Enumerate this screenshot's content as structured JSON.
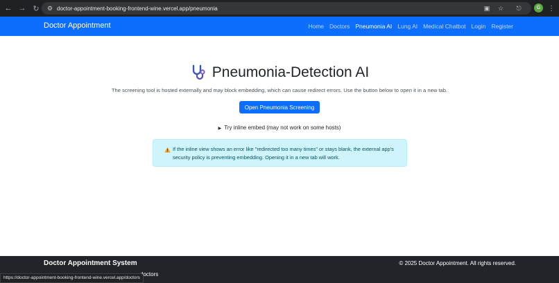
{
  "browser": {
    "url": "doctor-appointment-booking-frontend-wine.vercel.app/pneumonia",
    "profile_initial": "G",
    "status_url": "https://doctor-appointment-booking-frontend-wine.vercel.app/doctors"
  },
  "navbar": {
    "brand": "Doctor Appointment",
    "links": [
      {
        "label": "Home",
        "active": false
      },
      {
        "label": "Doctors",
        "active": false
      },
      {
        "label": "Pneumonia AI",
        "active": true
      },
      {
        "label": "Lung AI",
        "active": false
      },
      {
        "label": "Medical Chatbot",
        "active": false
      },
      {
        "label": "Login",
        "active": false
      },
      {
        "label": "Register",
        "active": false
      }
    ]
  },
  "main": {
    "title": "Pneumonia-Detection AI",
    "subtitle": "The screening tool is hosted externally and may block embedding, which can cause redirect errors. Use the button below to open it in a new tab.",
    "open_button": "Open Pneumonia Screening",
    "details_summary": "Try inline embed (may not work on some hosts)",
    "alert_text": "If the inline view shows an error like \"redirected too many times\" or stays blank, the external app's security policy is preventing embedding. Opening it in a new tab will work."
  },
  "footer": {
    "title": "Doctor Appointment System",
    "copyright": "© 2025 Doctor Appointment. All rights reserved.",
    "link": "doctors"
  },
  "colors": {
    "primary": "#0d6efd",
    "footer_bg": "#212529",
    "alert_bg": "#cff4fc",
    "alert_text": "#055160"
  }
}
